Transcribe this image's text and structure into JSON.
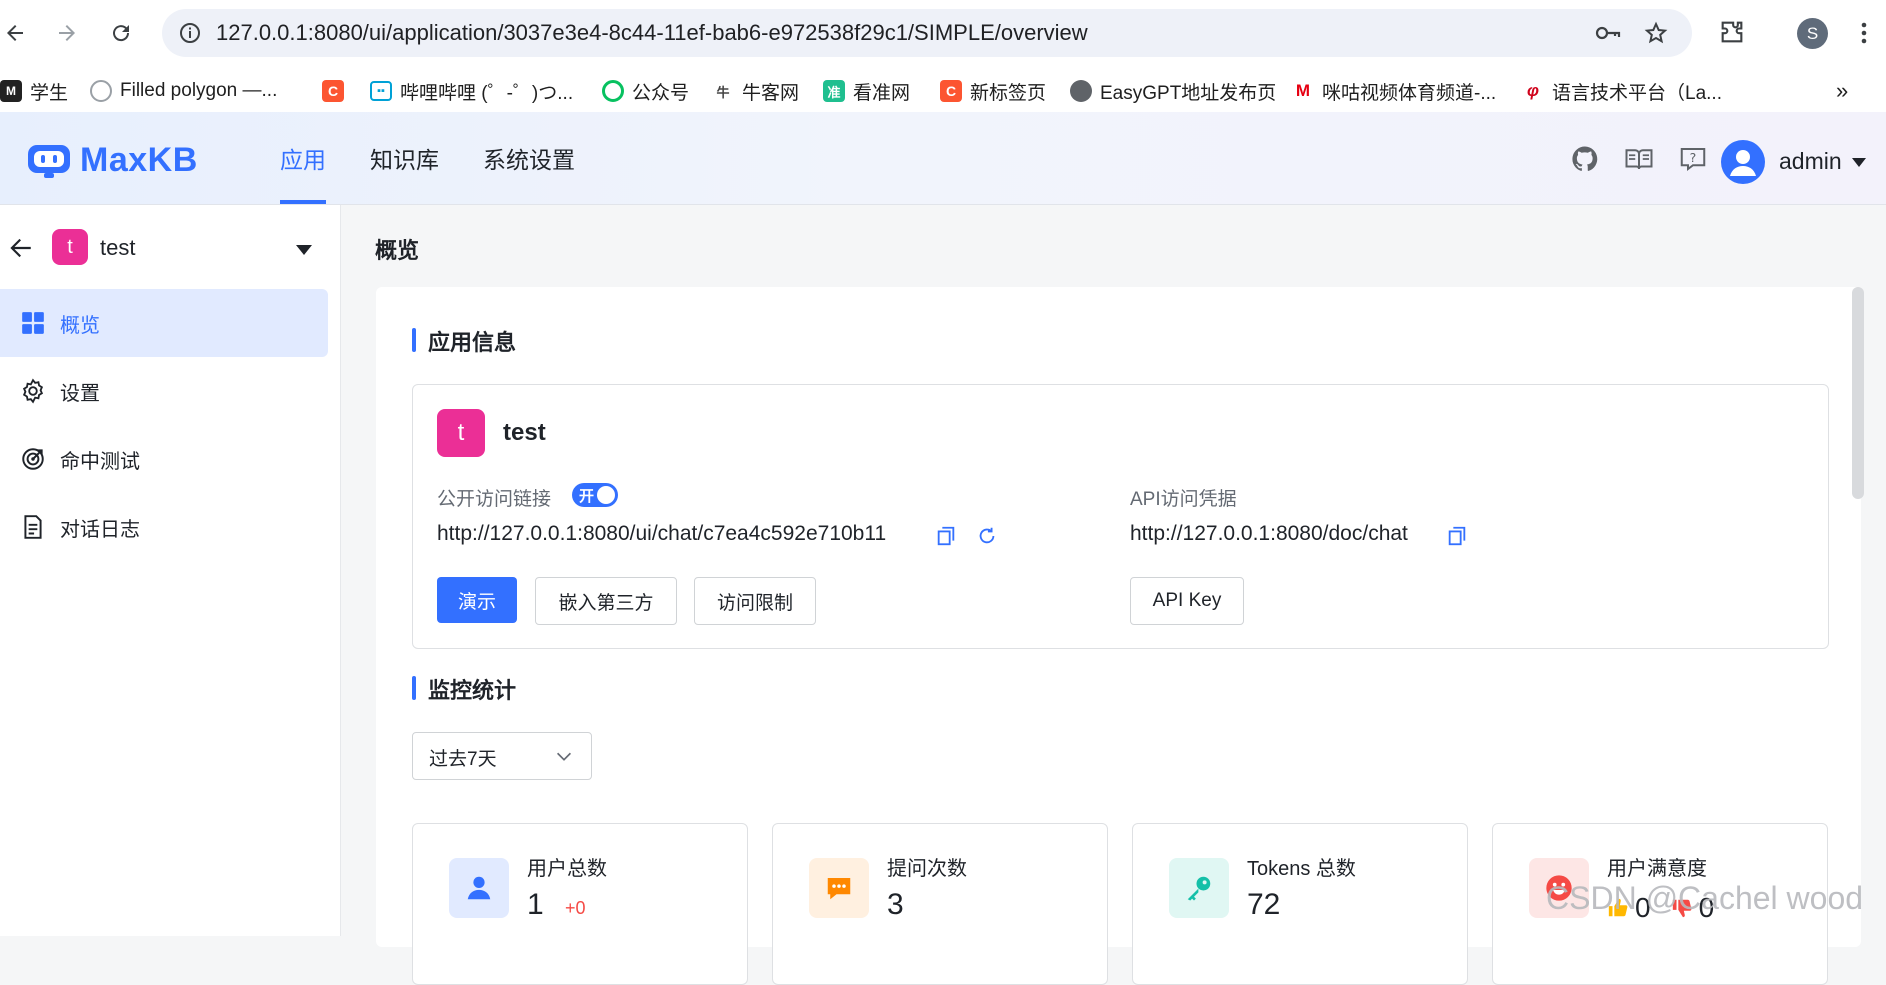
{
  "browser": {
    "url": "127.0.0.1:8080/ui/application/3037e3e4-8c44-11ef-bab6-e972538f29c1/SIMPLE/overview",
    "profile_initial": "S",
    "bookmarks": [
      {
        "label": "学生",
        "icon": "student-icon",
        "color": "#222222"
      },
      {
        "label": "Filled polygon —...",
        "icon": "polygon-icon",
        "color": "#9aa0a6"
      },
      {
        "label": "",
        "icon": "csdn-icon",
        "color": "#fc5531"
      },
      {
        "label": "哔哩哔哩 (゜-゜)つ...",
        "icon": "bilibili-icon",
        "color": "#00a1d6"
      },
      {
        "label": "公众号",
        "icon": "wechat-icon",
        "color": "#07c160"
      },
      {
        "label": "牛客网",
        "icon": "nowcoder-icon",
        "color": "#444444"
      },
      {
        "label": "看准网",
        "icon": "kanzhun-icon",
        "color": "#1fbf8f"
      },
      {
        "label": "新标签页",
        "icon": "csdn-icon",
        "color": "#fc5531"
      },
      {
        "label": "EasyGPT地址发布页",
        "icon": "globe-icon",
        "color": "#5f6368"
      },
      {
        "label": "咪咕视频体育频道-...",
        "icon": "migu-icon",
        "color": "#e60012"
      },
      {
        "label": "语言技术平台（La...",
        "icon": "ltp-icon",
        "color": "#d0021b"
      }
    ]
  },
  "header": {
    "brand": "MaxKB",
    "nav": [
      "应用",
      "知识库",
      "系统设置"
    ],
    "active_nav": 0,
    "user": "admin",
    "accent": "#3370ff"
  },
  "sidebar": {
    "app_initial": "t",
    "app_name": "test",
    "items": [
      {
        "label": "概览",
        "icon": "grid-icon"
      },
      {
        "label": "设置",
        "icon": "gear-icon"
      },
      {
        "label": "命中测试",
        "icon": "target-icon"
      },
      {
        "label": "对话日志",
        "icon": "document-icon"
      }
    ],
    "active": 0
  },
  "main": {
    "page_title": "概览",
    "app_info": {
      "section_title": "应用信息",
      "initial": "t",
      "name": "test",
      "public_link_label": "公开访问链接",
      "toggle_text": "开",
      "public_link": "http://127.0.0.1:8080/ui/chat/c7ea4c592e710b11",
      "api_label": "API访问凭据",
      "api_link": "http://127.0.0.1:8080/doc/chat",
      "buttons": [
        "演示",
        "嵌入第三方",
        "访问限制"
      ],
      "api_key_button": "API Key"
    },
    "monitor": {
      "section_title": "监控统计",
      "range": "过去7天",
      "stats": [
        {
          "label": "用户总数",
          "value": "1",
          "delta": "+0",
          "icon": "user-icon",
          "color": "#3370ff",
          "bg": "#e1eaff"
        },
        {
          "label": "提问次数",
          "value": "3",
          "icon": "chat-bubble-icon",
          "color": "#ff8800",
          "bg": "#fff0e0"
        },
        {
          "label": "Tokens 总数",
          "value": "72",
          "icon": "key-icon",
          "color": "#14c0a8",
          "bg": "#e0f7f3"
        },
        {
          "label": "用户满意度",
          "likes": "0",
          "dislikes": "0",
          "icon": "smile-icon",
          "color": "#f54a45",
          "bg": "#fde6e5"
        }
      ]
    }
  },
  "watermark": "CSDN @Cachel wood"
}
